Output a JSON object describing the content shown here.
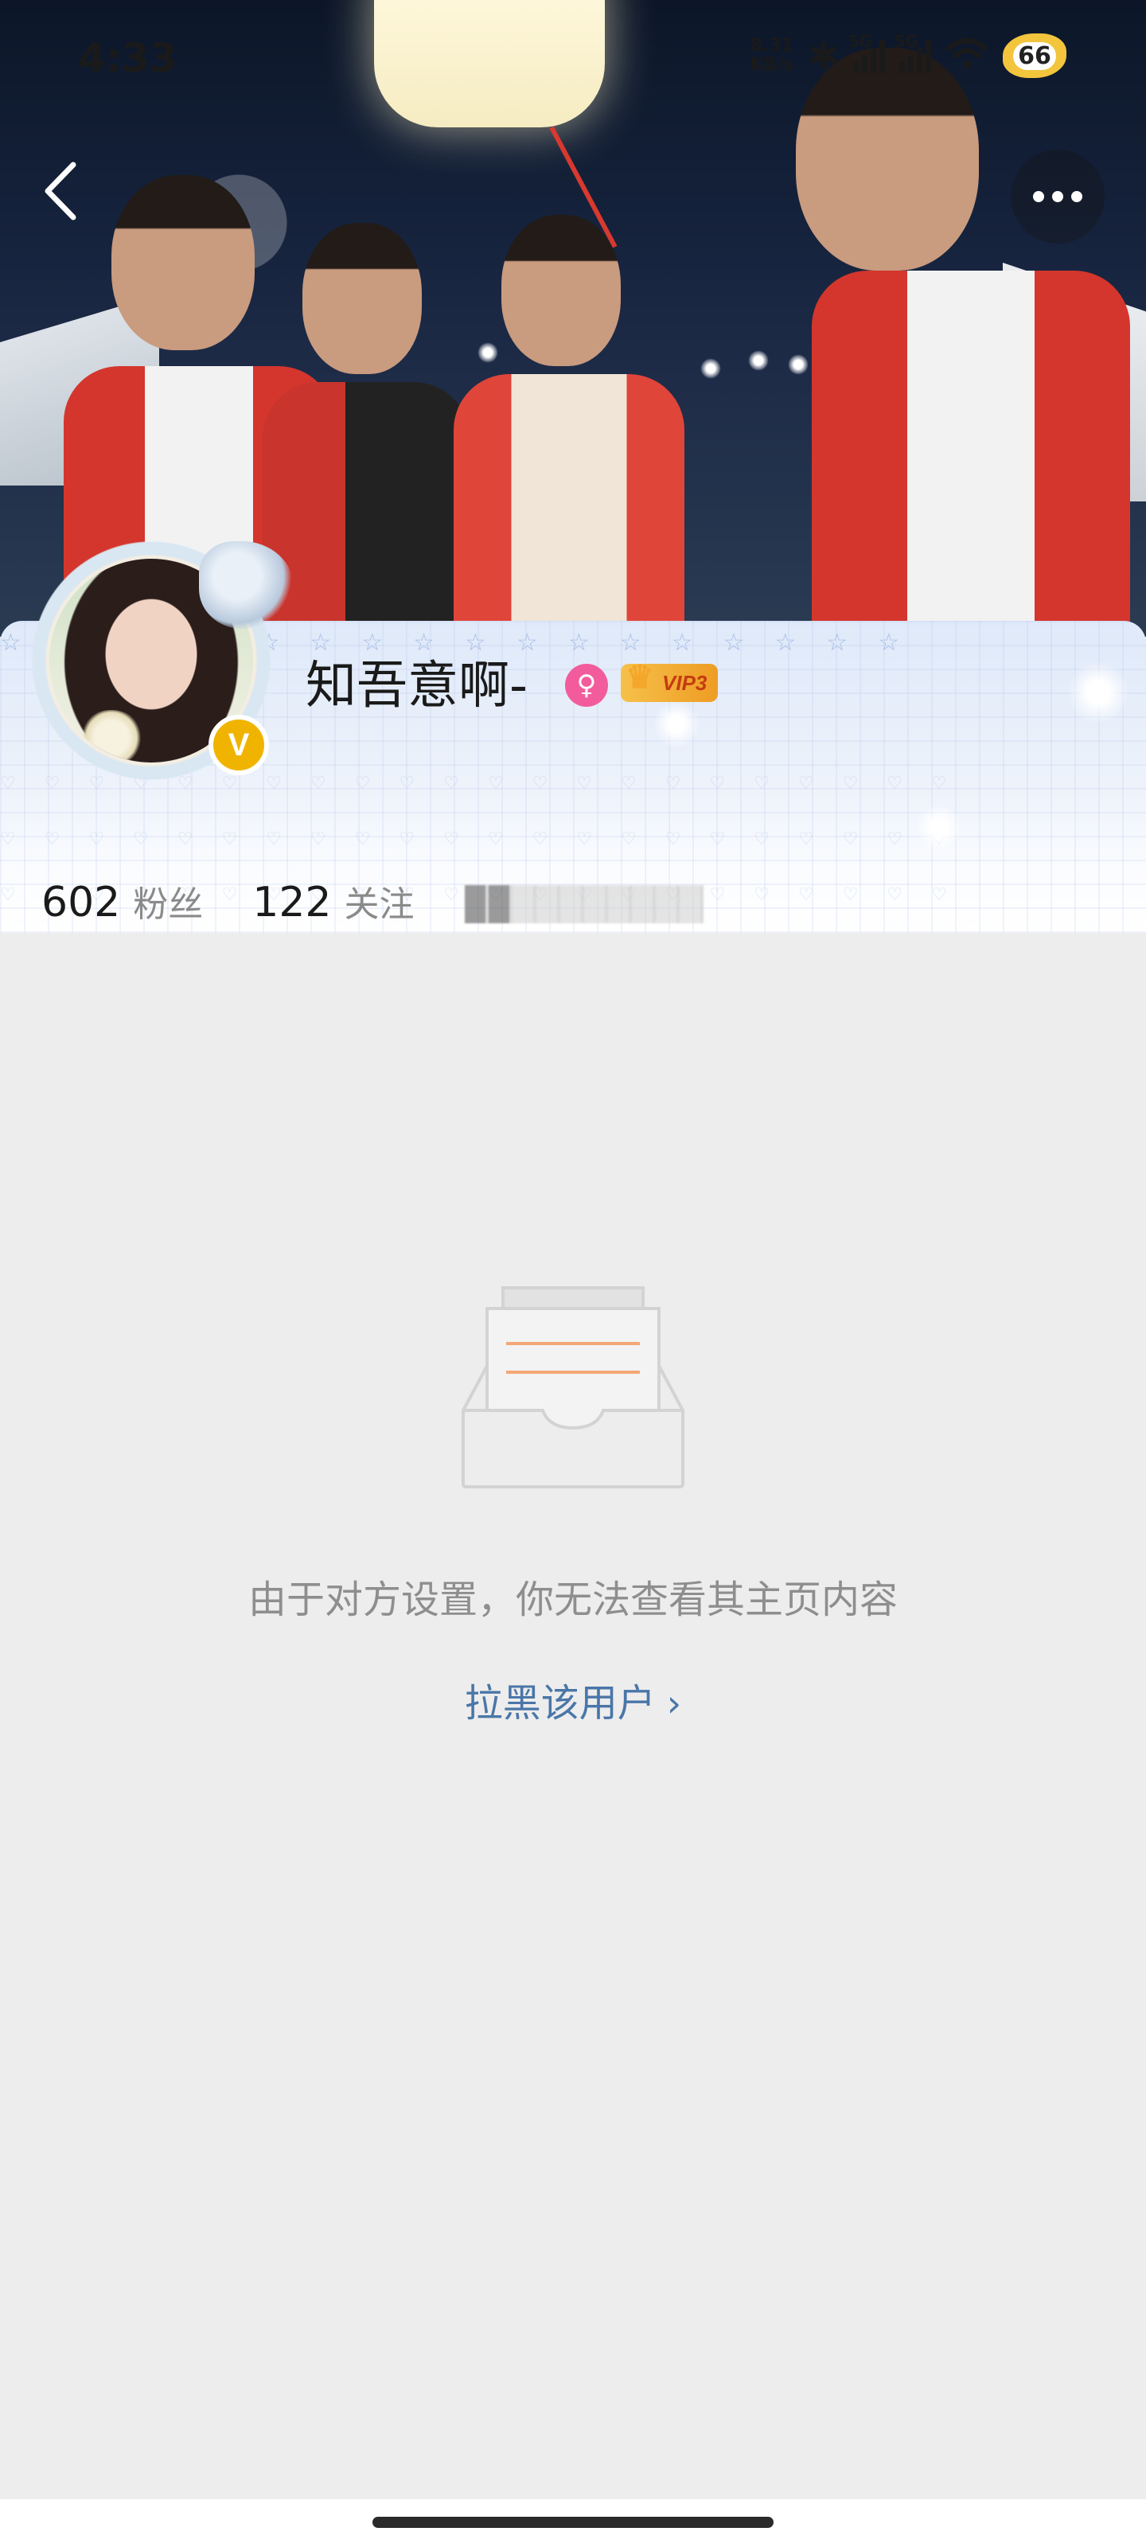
{
  "status_bar": {
    "time": "4:33",
    "net_speed_value": "8.31",
    "net_speed_unit": "KB/s",
    "signal_1_label": "5G",
    "signal_2_label": "5G",
    "battery_level": "66",
    "icons": [
      "bluetooth-icon",
      "signal-icon",
      "signal-icon",
      "wifi-icon",
      "battery-icon"
    ]
  },
  "nav": {
    "back_icon": "chevron-left-icon",
    "more_icon": "more-dots-icon"
  },
  "profile": {
    "username": "知吾意啊-",
    "gender_icon": "female-icon",
    "vip_label": "VIP3",
    "verified_glyph": "V",
    "stats": [
      {
        "value": "602",
        "label": "粉丝"
      },
      {
        "value": "122",
        "label": "关注"
      }
    ]
  },
  "empty_state": {
    "icon": "empty-tray-icon",
    "message": "由于对方设置，你无法查看其主页内容",
    "block_link": "拉黑该用户",
    "block_link_chevron": "›"
  },
  "colors": {
    "link": "#4a76a8",
    "vip_gold": "#f6c04a",
    "verified_gold": "#f0b400",
    "gender_pink": "#f25c9c",
    "background": "#ededed"
  }
}
